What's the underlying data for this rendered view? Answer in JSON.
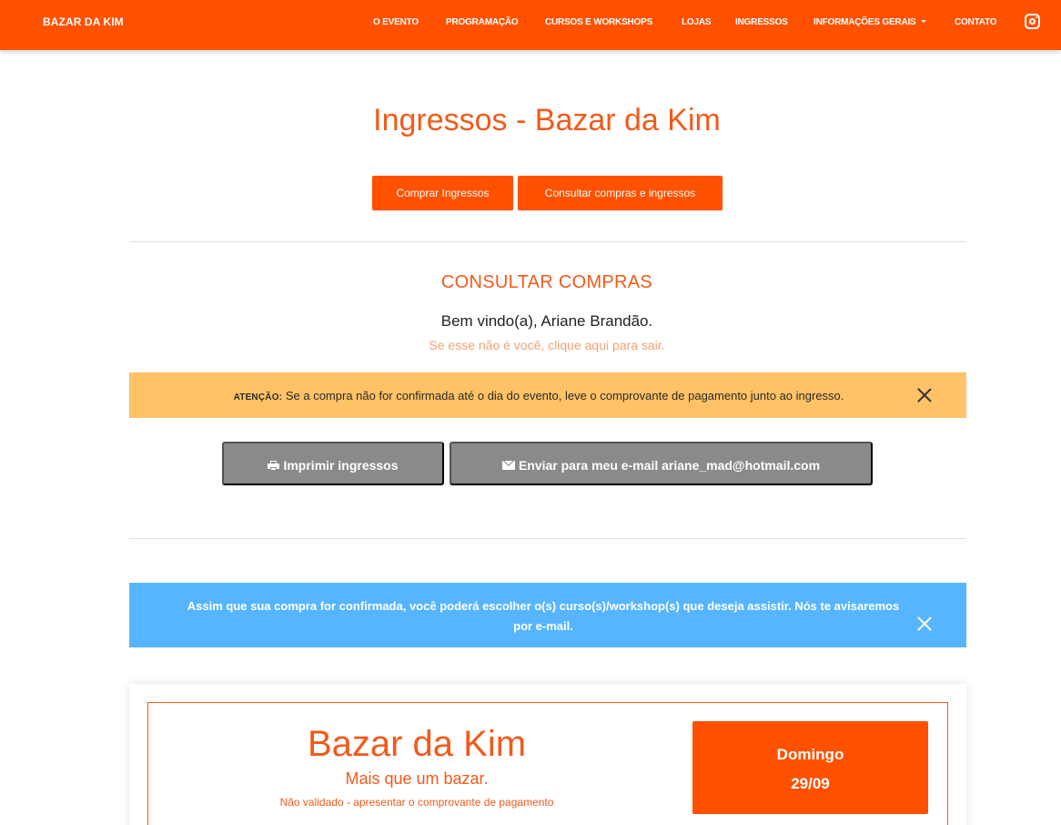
{
  "navbar": {
    "brand": "BAZAR DA KIM",
    "links": [
      "O EVENTO",
      "PROGRAMAÇÃO",
      "CURSOS E WORKSHOPS",
      "LOJAS",
      "INGRESSOS",
      "INFORMAÇÕES GERAIS",
      "CONTATO"
    ],
    "social_icon": "instagram-icon"
  },
  "page": {
    "title": "Ingressos - Bazar da Kim",
    "buttons": {
      "buy": "Comprar Ingressos",
      "consult": "Consultar compras e ingressos"
    }
  },
  "consult": {
    "title": "CONSULTAR COMPRAS",
    "welcome": "Bem vindo(a), Ariane Brandão.",
    "logout_link": "Se esse não é você, clique aqui para sair."
  },
  "warning_alert": {
    "label": "ATENÇÃO:",
    "text": "Se a compra não for confirmada até o dia do evento, leve o comprovante de pagamento junto ao ingresso."
  },
  "actions": {
    "print": "Imprimir ingressos",
    "email": "Enviar para meu e-mail ariane_mad@hotmail.com"
  },
  "info_alert": {
    "text": "Assim que sua compra for confirmada, você poderá escolher o(s) curso(s)/workshop(s) que deseja assistir. Nós te avisaremos por e-mail."
  },
  "ticket": {
    "title": "Bazar da Kim",
    "subtitle": "Mais que um bazar.",
    "note": "Não validado - apresentar o comprovante de pagamento",
    "day": "Domingo",
    "date": "29/09"
  },
  "colors": {
    "brand": "#ff5100",
    "title": "#f25a1a",
    "warning": "#ffc266",
    "info": "#57b5ff",
    "action_gray": "#8a8a8a"
  }
}
